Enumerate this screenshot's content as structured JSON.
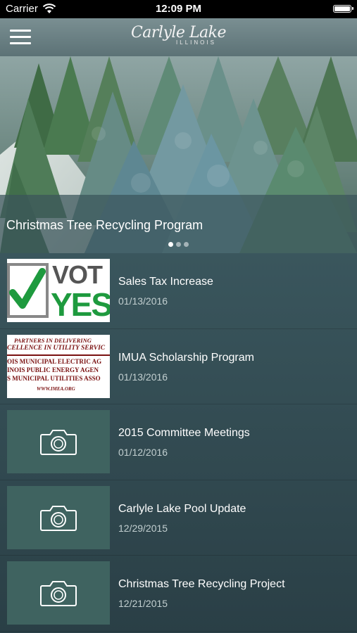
{
  "status_bar": {
    "carrier": "Carrier",
    "time": "12:09 PM"
  },
  "nav": {
    "logo_main": "Carlyle Lake",
    "logo_sub": "ILLINOIS"
  },
  "hero": {
    "title": "Christmas Tree Recycling Program",
    "dots": 3,
    "active_dot": 0
  },
  "news": [
    {
      "title": "Sales Tax Increase",
      "date": "01/13/2016",
      "thumb": "vote-yes-image",
      "thumb_text": {
        "vote": "VOT",
        "yes": "YES"
      }
    },
    {
      "title": "IMUA Scholarship Program",
      "date": "01/13/2016",
      "thumb": "imea-image",
      "thumb_text": {
        "line1": "PARTNERS IN DELIVERING",
        "line2": "CELLENCE IN UTILITY SERVIC",
        "line3": "OIS MUNICIPAL ELECTRIC AG",
        "line4": "INOIS PUBLIC ENERGY AGEN",
        "line5": "S MUNICIPAL UTILITIES ASSO",
        "line6": "WWW.IMEA.ORG"
      }
    },
    {
      "title": "2015 Committee Meetings",
      "date": "01/12/2016",
      "thumb": "camera-placeholder"
    },
    {
      "title": "Carlyle Lake Pool Update",
      "date": "12/29/2015",
      "thumb": "camera-placeholder"
    },
    {
      "title": "Christmas Tree Recycling Project",
      "date": "12/21/2015",
      "thumb": "camera-placeholder"
    }
  ],
  "colors": {
    "background": "#3a565d",
    "placeholder": "#3f6360",
    "date_text": "#c2cfd0"
  }
}
